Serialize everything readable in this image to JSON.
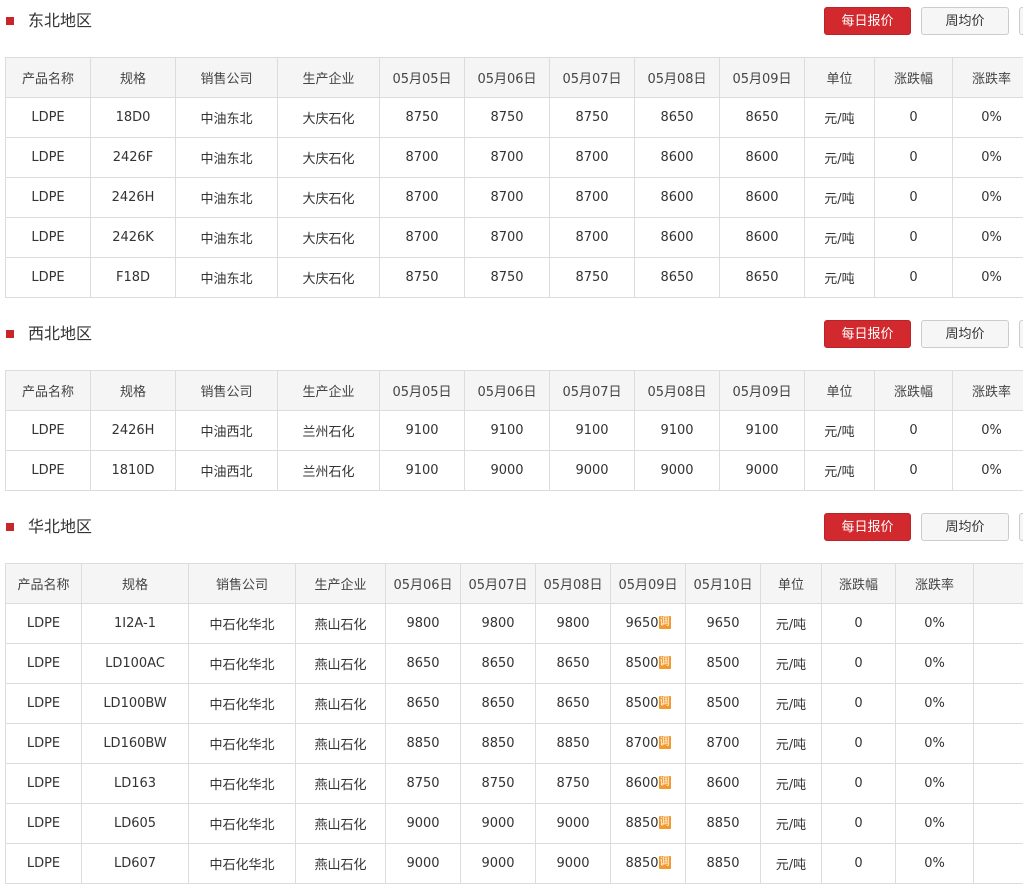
{
  "buttons": {
    "daily": "每日报价",
    "weekly": "周均价"
  },
  "colors": {
    "accent": "#d2292f",
    "link": "#2b5ebf",
    "down": "#3ca130",
    "adjust_badge": "#f29a2e"
  },
  "adjust_icon": {
    "glyph": "调",
    "name": "adjust-price-icon"
  },
  "sections": [
    {
      "title": "东北地区",
      "headers": [
        "产品名称",
        "规格",
        "销售公司",
        "生产企业",
        "05月05日",
        "05月06日",
        "05月07日",
        "05月08日",
        "05月09日",
        "单位",
        "涨跌幅",
        "涨跌率"
      ],
      "rows": [
        {
          "cells": [
            "LDPE",
            "18D0",
            "中油东北",
            "大庆石化",
            "8750",
            "8750",
            "8750",
            "8650",
            "8650",
            "元/吨",
            "0",
            "0%"
          ],
          "green": [
            4,
            7
          ],
          "adjusted": []
        },
        {
          "cells": [
            "LDPE",
            "2426F",
            "中油东北",
            "大庆石化",
            "8700",
            "8700",
            "8700",
            "8600",
            "8600",
            "元/吨",
            "0",
            "0%"
          ],
          "green": [
            4,
            7
          ],
          "adjusted": []
        },
        {
          "cells": [
            "LDPE",
            "2426H",
            "中油东北",
            "大庆石化",
            "8700",
            "8700",
            "8700",
            "8600",
            "8600",
            "元/吨",
            "0",
            "0%"
          ],
          "green": [
            4,
            7
          ],
          "adjusted": []
        },
        {
          "cells": [
            "LDPE",
            "2426K",
            "中油东北",
            "大庆石化",
            "8700",
            "8700",
            "8700",
            "8600",
            "8600",
            "元/吨",
            "0",
            "0%"
          ],
          "green": [
            4,
            7
          ],
          "adjusted": []
        },
        {
          "cells": [
            "LDPE",
            "F18D",
            "中油东北",
            "大庆石化",
            "8750",
            "8750",
            "8750",
            "8650",
            "8650",
            "元/吨",
            "0",
            "0%"
          ],
          "green": [
            4,
            7
          ],
          "adjusted": []
        }
      ]
    },
    {
      "title": "西北地区",
      "headers": [
        "产品名称",
        "规格",
        "销售公司",
        "生产企业",
        "05月05日",
        "05月06日",
        "05月07日",
        "05月08日",
        "05月09日",
        "单位",
        "涨跌幅",
        "涨跌率"
      ],
      "rows": [
        {
          "cells": [
            "LDPE",
            "2426H",
            "中油西北",
            "兰州石化",
            "9100",
            "9100",
            "9100",
            "9100",
            "9100",
            "元/吨",
            "0",
            "0%"
          ],
          "green": [],
          "adjusted": []
        },
        {
          "cells": [
            "LDPE",
            "1810D",
            "中油西北",
            "兰州石化",
            "9100",
            "9000",
            "9000",
            "9000",
            "9000",
            "元/吨",
            "0",
            "0%"
          ],
          "green": [
            5
          ],
          "adjusted": []
        }
      ]
    },
    {
      "title": "华北地区",
      "headers": [
        "产品名称",
        "规格",
        "销售公司",
        "生产企业",
        "05月06日",
        "05月07日",
        "05月08日",
        "05月09日",
        "05月10日",
        "单位",
        "涨跌幅",
        "涨跌率",
        ""
      ],
      "rows": [
        {
          "cells": [
            "LDPE",
            "1I2A-1",
            "中石化华北",
            "燕山石化",
            "9800",
            "9800",
            "9800",
            "9650",
            "9650",
            "元/吨",
            "0",
            "0%",
            ""
          ],
          "green": [
            4
          ],
          "adjusted": [
            7
          ]
        },
        {
          "cells": [
            "LDPE",
            "LD100AC",
            "中石化华北",
            "燕山石化",
            "8650",
            "8650",
            "8650",
            "8500",
            "8500",
            "元/吨",
            "0",
            "0%",
            ""
          ],
          "green": [
            4
          ],
          "adjusted": [
            7
          ]
        },
        {
          "cells": [
            "LDPE",
            "LD100BW",
            "中石化华北",
            "燕山石化",
            "8650",
            "8650",
            "8650",
            "8500",
            "8500",
            "元/吨",
            "0",
            "0%",
            ""
          ],
          "green": [
            4
          ],
          "adjusted": [
            7
          ]
        },
        {
          "cells": [
            "LDPE",
            "LD160BW",
            "中石化华北",
            "燕山石化",
            "8850",
            "8850",
            "8850",
            "8700",
            "8700",
            "元/吨",
            "0",
            "0%",
            ""
          ],
          "green": [
            4
          ],
          "adjusted": [
            7
          ]
        },
        {
          "cells": [
            "LDPE",
            "LD163",
            "中石化华北",
            "燕山石化",
            "8750",
            "8750",
            "8750",
            "8600",
            "8600",
            "元/吨",
            "0",
            "0%",
            ""
          ],
          "green": [
            4
          ],
          "adjusted": [
            7
          ]
        },
        {
          "cells": [
            "LDPE",
            "LD605",
            "中石化华北",
            "燕山石化",
            "9000",
            "9000",
            "9000",
            "8850",
            "8850",
            "元/吨",
            "0",
            "0%",
            ""
          ],
          "green": [
            4
          ],
          "adjusted": [
            7
          ]
        },
        {
          "cells": [
            "LDPE",
            "LD607",
            "中石化华北",
            "燕山石化",
            "9000",
            "9000",
            "9000",
            "8850",
            "8850",
            "元/吨",
            "0",
            "0%",
            ""
          ],
          "green": [
            4
          ],
          "adjusted": [
            7
          ]
        }
      ]
    }
  ]
}
